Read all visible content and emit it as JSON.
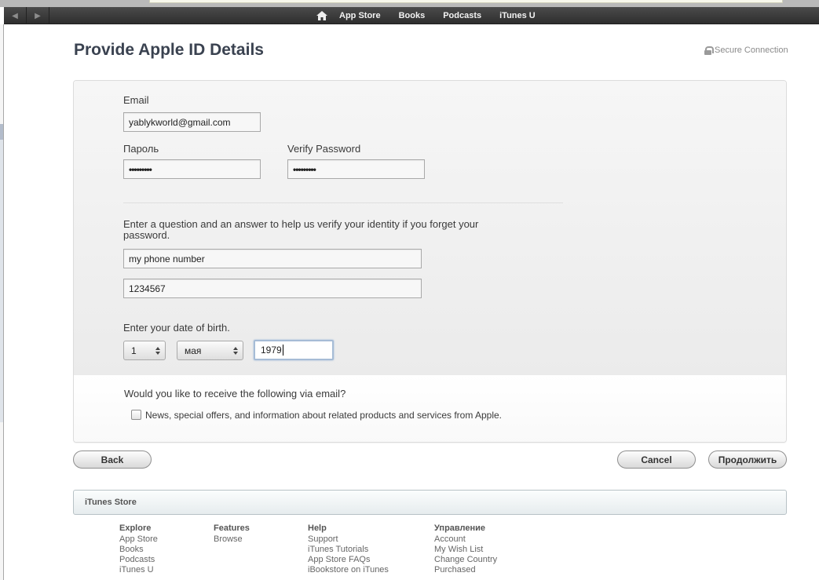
{
  "nav": {
    "back_label": "◀",
    "forward_label": "▶",
    "home_label": "⌂",
    "links": [
      "App Store",
      "Books",
      "Podcasts",
      "iTunes U"
    ]
  },
  "page": {
    "title": "Provide Apple ID Details",
    "secure_label": "Secure Connection"
  },
  "form": {
    "email_label": "Email",
    "email_value": "yablykworld@gmail.com",
    "password_label": "Пароль",
    "password_value": "•••••••••",
    "verify_label": "Verify Password",
    "verify_value": "•••••••••",
    "question_prompt": "Enter a question and an answer to help us verify your identity if you forget your password.",
    "question_value": "my phone number",
    "answer_value": "1234567",
    "dob_prompt": "Enter your date of birth.",
    "dob_day": "1",
    "dob_month": "мая",
    "dob_year": "1979",
    "email_optin_prompt": "Would you like to receive the following via email?",
    "newsletter_label": "News, special offers, and information about related products and services from Apple.",
    "newsletter_checked": false
  },
  "buttons": {
    "back": "Back",
    "cancel": "Cancel",
    "continue": "Продолжить"
  },
  "footer": {
    "bar_title": "iTunes Store",
    "columns": [
      {
        "heading": "Explore",
        "links": [
          "App Store",
          "Books",
          "Podcasts",
          "iTunes U"
        ]
      },
      {
        "heading": "Features",
        "links": [
          "Browse"
        ]
      },
      {
        "heading": "Help",
        "links": [
          "Support",
          "iTunes Tutorials",
          "App Store FAQs",
          "iBookstore on iTunes"
        ]
      },
      {
        "heading": "Управление",
        "links": [
          "Account",
          "My Wish List",
          "Change Country",
          "Purchased"
        ]
      }
    ]
  }
}
